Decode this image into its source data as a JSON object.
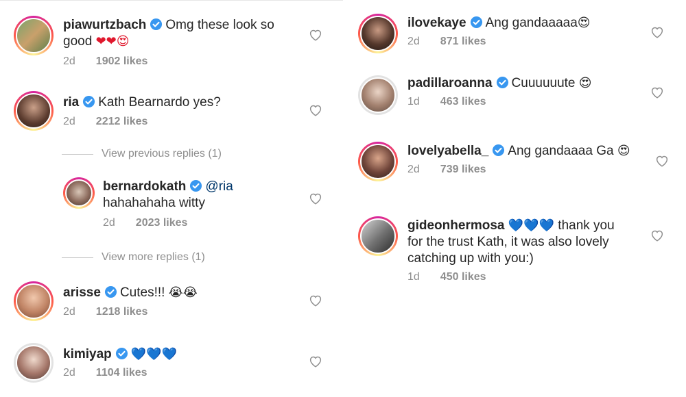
{
  "left": {
    "comments": [
      {
        "user": "piawurtzbach",
        "text1": "Omg these look so",
        "text2": "good",
        "emojis": "❤❤😍",
        "time": "2d",
        "likes": "1902 likes"
      },
      {
        "user": "ria",
        "text1": "Kath Bearnardo yes?",
        "time": "2d",
        "likes": "2212 likes"
      },
      {
        "user": "arisse",
        "text1": "Cutes!!!",
        "emojis": "😭😭",
        "time": "2d",
        "likes": "1218 likes"
      },
      {
        "user": "kimiyap",
        "emojis": "💙💙💙",
        "time": "2d",
        "likes": "1104 likes"
      }
    ],
    "view_previous": "View previous replies (1)",
    "view_more": "View more replies (1)",
    "reply": {
      "user": "bernardokath",
      "mention": "@ria",
      "text2": "hahahahaha witty",
      "time": "2d",
      "likes": "2023 likes"
    }
  },
  "right": {
    "comments": [
      {
        "user": "ilovekaye",
        "text1": "Ang gandaaaaa",
        "emojis": "😍",
        "time": "2d",
        "likes": "871 likes"
      },
      {
        "user": "padillaroanna",
        "text1": "Cuuuuuute",
        "emojis": "😍",
        "time": "1d",
        "likes": "463 likes"
      },
      {
        "user": "lovelyabella_",
        "text1": "Ang gandaaaa Ga",
        "emojis": "😍",
        "time": "2d",
        "likes": "739 likes"
      },
      {
        "user": "gideonhermosa",
        "emojis": "💙💙💙",
        "text1": "thank you",
        "text2": "for the trust Kath, it was also lovely",
        "text3": "catching up with you:)",
        "time": "1d",
        "likes": "450 likes"
      }
    ]
  },
  "colors": {
    "accent_blue": "#3897f0",
    "muted": "#8e8e8e",
    "text": "#262626",
    "heart_red": "#e0182d"
  },
  "icons": {
    "verified": "verified-badge-icon",
    "like": "heart-outline-icon"
  }
}
